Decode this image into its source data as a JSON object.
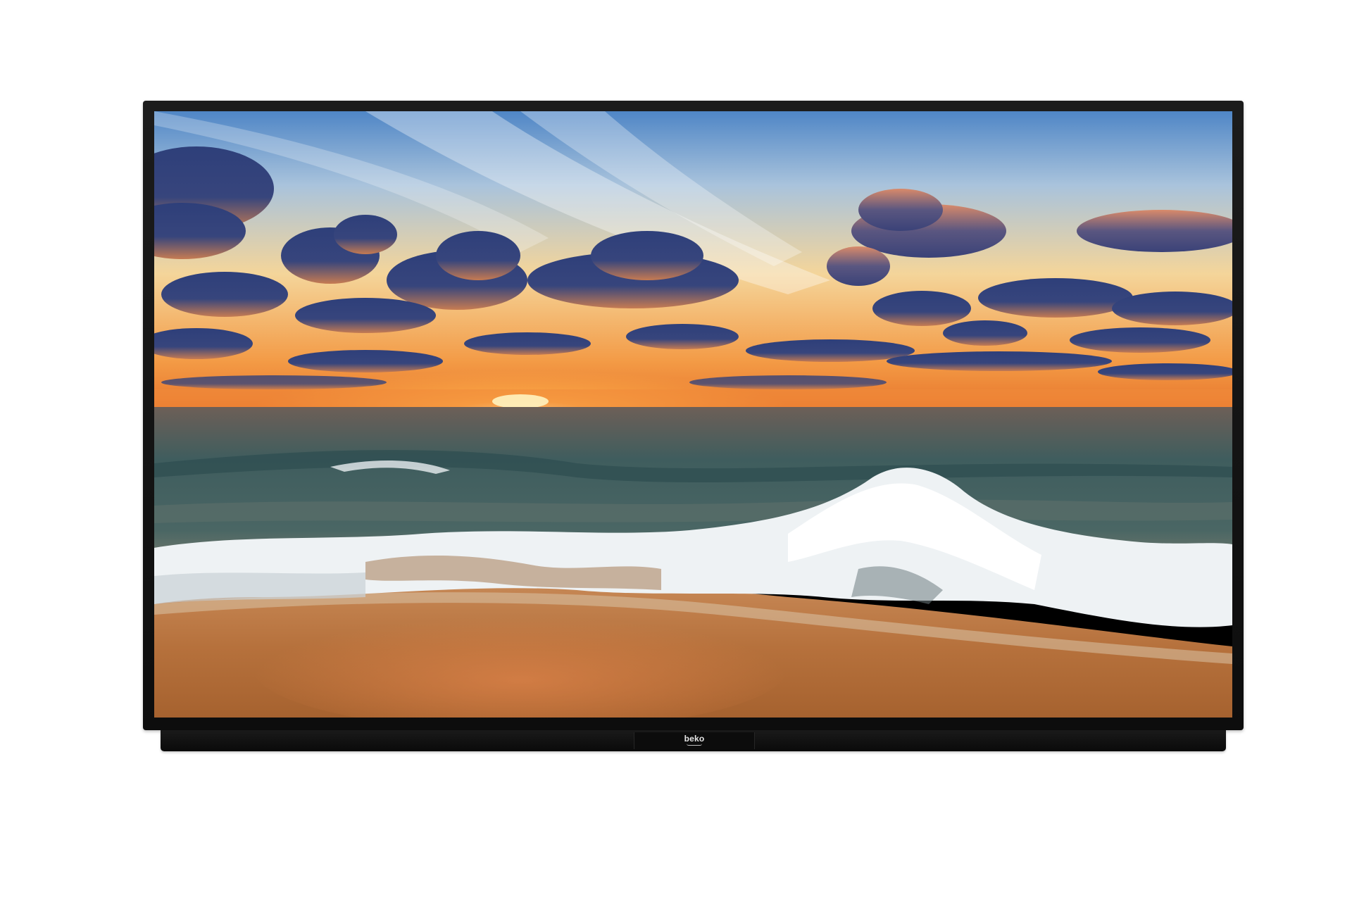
{
  "product": {
    "brand_logo": "beko",
    "frame_color": "#111111",
    "screen_content": {
      "sky_colors": [
        "#5b8fc9",
        "#f2c98a",
        "#f08a3a"
      ],
      "sea_color": "#3c5a5a",
      "sand_color": "#b5703a",
      "foam_color": "#f4f6f8"
    }
  }
}
